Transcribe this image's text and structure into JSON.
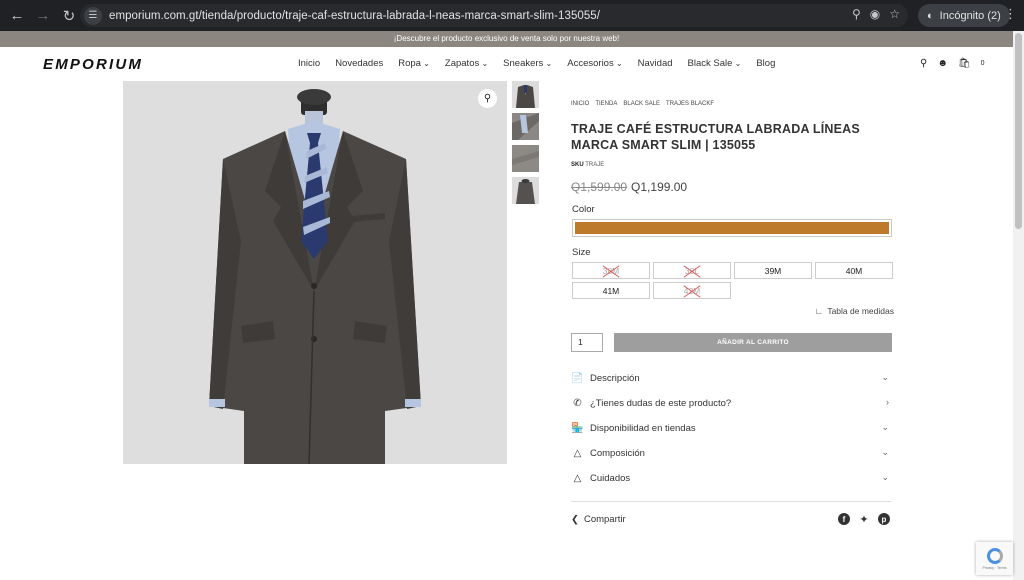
{
  "browser": {
    "url": "emporium.com.gt/tienda/producto/traje-caf-estructura-labrada-l-neas-marca-smart-slim-135055/",
    "incognito_label": "Incógnito (2)"
  },
  "announcement": "¡Descubre el producto exclusivo de venta solo por nuestra web!",
  "site": {
    "logo": "EMPORIUM",
    "nav": [
      {
        "label": "Inicio"
      },
      {
        "label": "Novedades"
      },
      {
        "label": "Ropa"
      },
      {
        "label": "Zapatos"
      },
      {
        "label": "Sneakers"
      },
      {
        "label": "Accesorios"
      },
      {
        "label": "Navidad"
      },
      {
        "label": "Black Sale"
      },
      {
        "label": "Blog"
      }
    ],
    "cart_count": "0"
  },
  "product": {
    "breadcrumb": [
      "INICIO",
      "TIENDA",
      "BLACK SALE",
      "TRAJES BLACKF"
    ],
    "title": "TRAJE CAFÉ ESTRUCTURA LABRADA LÍNEAS MARCA SMART SLIM | 135055",
    "sku_label": "SKU",
    "sku_value": "TRAJE",
    "price_old": "Q1,599.00",
    "price_new": "Q1,199.00",
    "color_label": "Color",
    "color_swatch": "#bd7a2a",
    "size_label": "Size",
    "sizes": [
      {
        "label": "38M",
        "available": false
      },
      {
        "label": "38L",
        "available": false
      },
      {
        "label": "39M",
        "available": true
      },
      {
        "label": "40M",
        "available": true
      },
      {
        "label": "41M",
        "available": true
      },
      {
        "label": "42M",
        "available": false
      }
    ],
    "size_guide": "Tabla de medidas",
    "quantity": "1",
    "add_to_cart": "AÑADIR AL CARRITO"
  },
  "accordion": [
    {
      "label": "Descripción",
      "icon": "document-icon",
      "chevron": "down"
    },
    {
      "label": "¿Tienes dudas de este producto?",
      "icon": "whatsapp-icon",
      "chevron": "right"
    },
    {
      "label": "Disponibilidad en tiendas",
      "icon": "store-icon",
      "chevron": "down"
    },
    {
      "label": "Composición",
      "icon": "shapes-icon",
      "chevron": "down"
    },
    {
      "label": "Cuidados",
      "icon": "hanger-icon",
      "chevron": "down"
    }
  ],
  "share_label": "Compartir"
}
